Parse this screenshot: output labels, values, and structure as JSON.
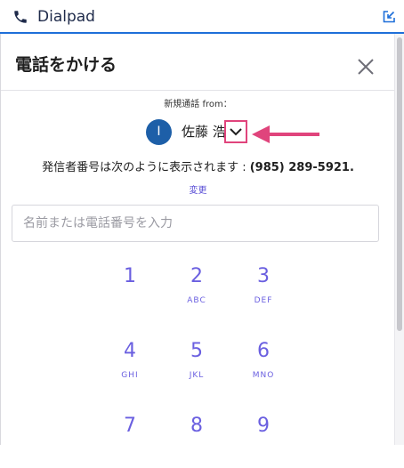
{
  "app": {
    "title": "Dialpad"
  },
  "panel": {
    "title": "電話をかける",
    "from_label": "新規通話 from：",
    "caller": {
      "avatar_initial": "I",
      "name": "佐藤 浩"
    },
    "caller_id_prefix": "発信者番号は次のように表示されます : ",
    "caller_id_number": "(985) 289-5921.",
    "change_label": "変更",
    "search_placeholder": "名前または電話番号を入力"
  },
  "keypad": [
    {
      "digit": "1",
      "letters": ""
    },
    {
      "digit": "2",
      "letters": "ABC"
    },
    {
      "digit": "3",
      "letters": "DEF"
    },
    {
      "digit": "4",
      "letters": "GHI"
    },
    {
      "digit": "5",
      "letters": "JKL"
    },
    {
      "digit": "6",
      "letters": "MNO"
    },
    {
      "digit": "7",
      "letters": ""
    },
    {
      "digit": "8",
      "letters": ""
    },
    {
      "digit": "9",
      "letters": ""
    }
  ],
  "colors": {
    "accent": "#6a5fe0",
    "topbar_border": "#1e6fd9",
    "avatar": "#1d5fa8",
    "annotation": "#e0447c"
  }
}
